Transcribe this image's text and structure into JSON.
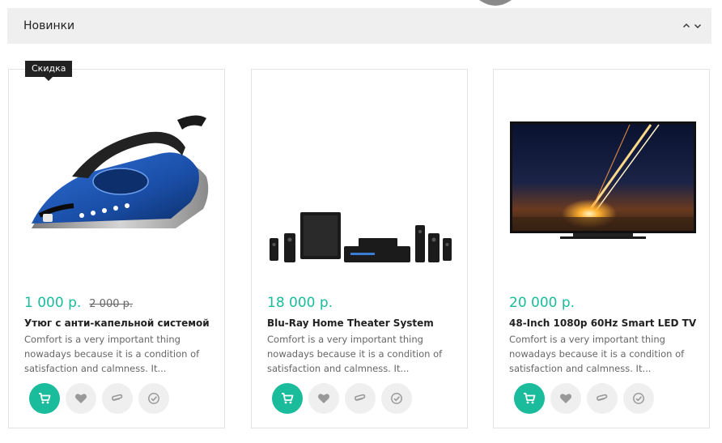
{
  "section": {
    "title": "Новинки"
  },
  "colors": {
    "accent": "#1abc9c",
    "header_bg": "#efefef",
    "badge_bg": "#222222",
    "button_bg": "#efefef"
  },
  "icons": {
    "prev": "chevron-up-icon",
    "next": "chevron-down-icon",
    "cart": "cart-icon",
    "wishlist": "heart-icon",
    "compare": "paperclip-icon",
    "check": "check-circle-icon"
  },
  "products": [
    {
      "badge": "Скидка",
      "price": "1 000 р.",
      "old_price": "2 000 р.",
      "name": "Утюг с анти-капельной системой",
      "description": "Comfort is a very important thing nowadays because it is a condition of satisfaction and calmness. It...",
      "image": "steam-iron"
    },
    {
      "price": "18 000 р.",
      "name": "Blu-Ray Home Theater System",
      "description": "Comfort is a very important thing nowadays because it is a condition of satisfaction and calmness. It...",
      "image": "home-theater-system"
    },
    {
      "price": "20 000 р.",
      "name": "48-Inch 1080p 60Hz Smart LED TV",
      "description": "Comfort is a very important thing nowadays because it is a condition of satisfaction and calmness. It...",
      "image": "led-tv"
    }
  ]
}
